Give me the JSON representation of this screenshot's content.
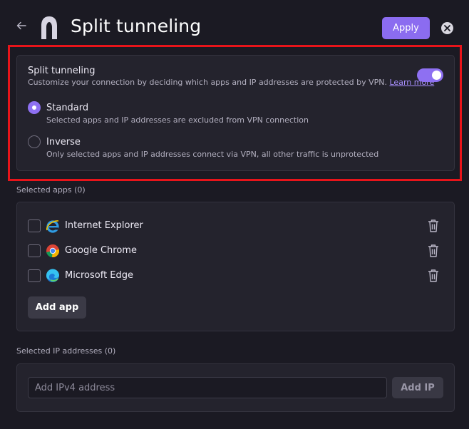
{
  "header": {
    "back_icon": "arrow-left-icon",
    "logo_icon": "vpn-shield-logo",
    "title": "Split tunneling",
    "apply_label": "Apply",
    "close_icon": "close-circle-icon"
  },
  "split": {
    "title": "Split tunneling",
    "description": "Customize your connection by deciding which apps and IP addresses are protected by VPN.",
    "learn_more": "Learn more",
    "enabled": true,
    "options": [
      {
        "label": "Standard",
        "description": "Selected apps and IP addresses are excluded from VPN connection",
        "selected": true
      },
      {
        "label": "Inverse",
        "description": "Only selected apps and IP addresses connect via VPN, all other traffic is unprotected",
        "selected": false
      }
    ]
  },
  "apps": {
    "section_label": "Selected apps (0)",
    "items": [
      {
        "name": "Internet Explorer",
        "icon": "internet-explorer-icon",
        "checked": false
      },
      {
        "name": "Google Chrome",
        "icon": "google-chrome-icon",
        "checked": false
      },
      {
        "name": "Microsoft Edge",
        "icon": "microsoft-edge-icon",
        "checked": false
      }
    ],
    "add_label": "Add app"
  },
  "ips": {
    "section_label": "Selected IP addresses (0)",
    "input_value": "",
    "input_placeholder": "Add IPv4 address",
    "add_label": "Add IP"
  },
  "colors": {
    "background": "#1b1a23",
    "card": "#24232d",
    "accent": "#8b6cf0",
    "highlight_border": "#e8141a",
    "link": "#a990ff"
  }
}
